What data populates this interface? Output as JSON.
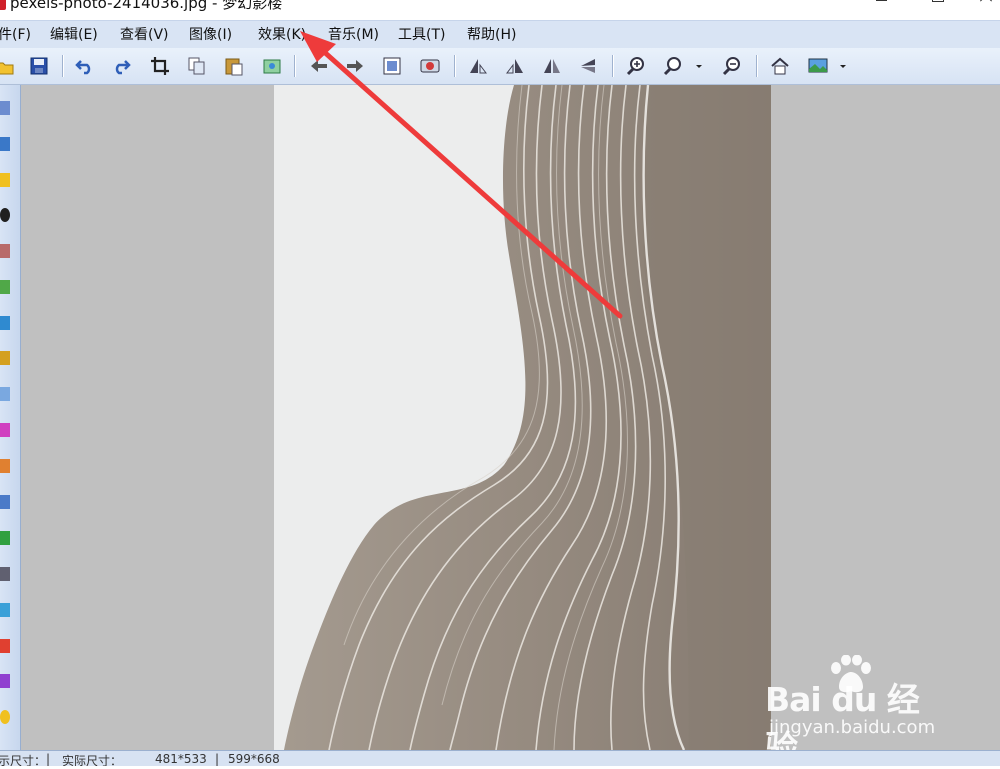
{
  "window": {
    "title": "pexels-photo-2414036.jpg - 梦幻影楼",
    "minimize": "—",
    "maximize": "☐",
    "close": "✕"
  },
  "menu": [
    {
      "label": "件(F)"
    },
    {
      "label": "编辑(E)"
    },
    {
      "label": "查看(V)"
    },
    {
      "label": "图像(I)"
    },
    {
      "label": "效果(K)"
    },
    {
      "label": "音乐(M)"
    },
    {
      "label": "工具(T)"
    },
    {
      "label": "帮助(H)"
    }
  ],
  "toolbar": {
    "icons": [
      "open-icon",
      "save-icon",
      "undo-icon",
      "redo-icon",
      "crop-icon",
      "copy-icon",
      "paste-icon",
      "export-icon",
      "prev-icon",
      "next-icon",
      "fit-screen-icon",
      "slideshow-icon",
      "rotate-left-icon",
      "rotate-right-icon",
      "flip-horizontal-icon",
      "flip-vertical-icon",
      "zoom-in-icon",
      "zoom-icon",
      "dropdown-arrow-icon",
      "zoom-out-icon",
      "home-icon",
      "wallpaper-icon",
      "dropdown-arrow-icon"
    ]
  },
  "status": {
    "display_size_label": "显示尺寸：",
    "display_size": "481*533",
    "actual_size_label": "实际尺寸：",
    "actual_size": "599*668"
  },
  "watermark": {
    "brand": "Bai du 经验",
    "url": "jingyan.baidu.com"
  },
  "colors": {
    "menubar": "#d9e4f4",
    "workspace": "#c0c0c0",
    "arrow": "#ee3b3b"
  }
}
